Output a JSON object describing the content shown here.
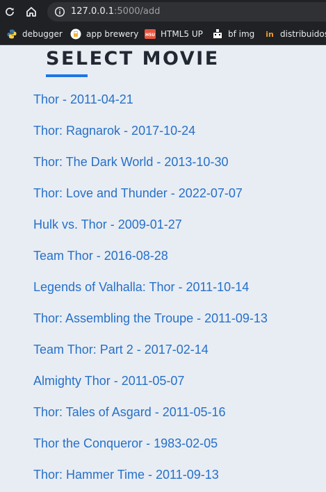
{
  "browser": {
    "url_host": "127.0.0.1",
    "url_rest": ":5000/add",
    "bookmarks": [
      {
        "label": "debugger",
        "icon": "python-icon"
      },
      {
        "label": "app brewery",
        "icon": "app-brewery-icon"
      },
      {
        "label": "HTML5 UP",
        "icon": "html5up-icon",
        "icon_text": "H5U"
      },
      {
        "label": "bf img",
        "icon": "pixel-icon"
      },
      {
        "label": "distribuidos",
        "icon": "in-icon",
        "icon_text": "in"
      }
    ]
  },
  "page": {
    "title": "SELECT MOVIE",
    "accent_color": "#1e74e8",
    "link_color": "#2670c9",
    "background": "#e8edf3"
  },
  "movies": [
    "Thor - 2011-04-21",
    "Thor: Ragnarok - 2017-10-24",
    "Thor: The Dark World - 2013-10-30",
    "Thor: Love and Thunder - 2022-07-07",
    "Hulk vs. Thor - 2009-01-27",
    "Team Thor - 2016-08-28",
    "Legends of Valhalla: Thor - 2011-10-14",
    "Thor: Assembling the Troupe - 2011-09-13",
    "Team Thor: Part 2 - 2017-02-14",
    "Almighty Thor - 2011-05-07",
    "Thor: Tales of Asgard - 2011-05-16",
    "Thor the Conqueror - 1983-02-05",
    "Thor: Hammer Time - 2011-09-13"
  ]
}
